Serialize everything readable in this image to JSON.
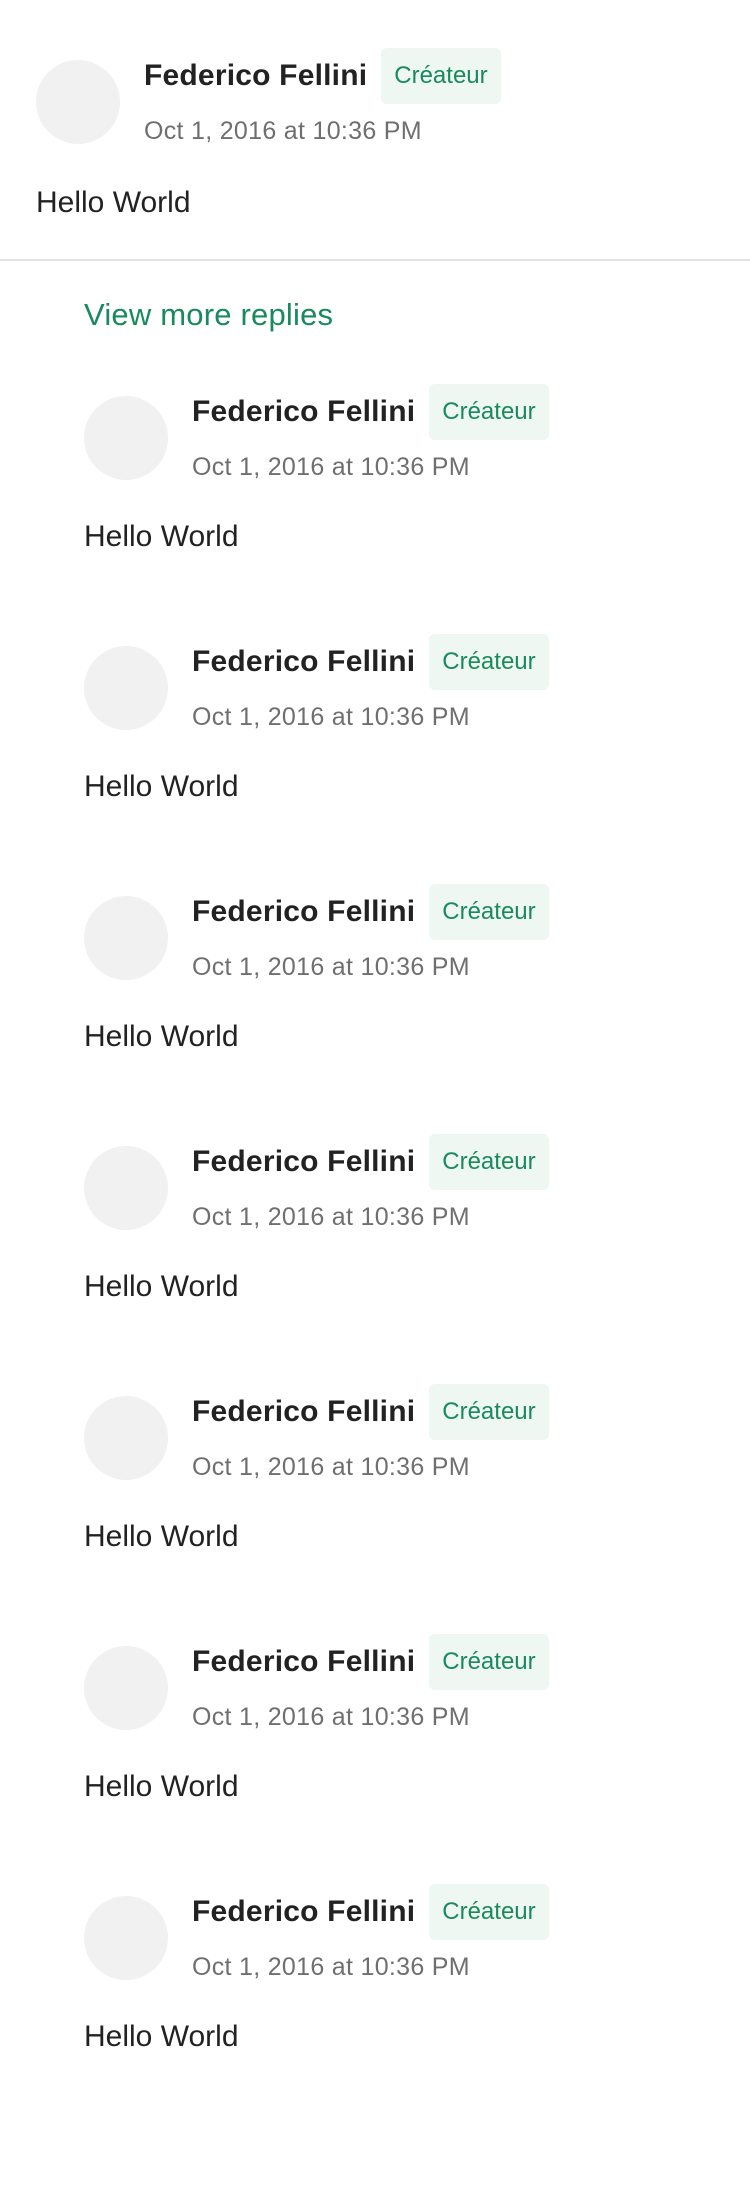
{
  "root_comment": {
    "author": "Federico Fellini",
    "badge": "Créateur",
    "timestamp": "Oct 1, 2016 at 10:36 PM",
    "text": "Hello World"
  },
  "view_more_label": "View more replies",
  "replies": [
    {
      "author": "Federico Fellini",
      "badge": "Créateur",
      "timestamp": "Oct 1, 2016 at 10:36 PM",
      "text": "Hello World"
    },
    {
      "author": "Federico Fellini",
      "badge": "Créateur",
      "timestamp": "Oct 1, 2016 at 10:36 PM",
      "text": "Hello World"
    },
    {
      "author": "Federico Fellini",
      "badge": "Créateur",
      "timestamp": "Oct 1, 2016 at 10:36 PM",
      "text": "Hello World"
    },
    {
      "author": "Federico Fellini",
      "badge": "Créateur",
      "timestamp": "Oct 1, 2016 at 10:36 PM",
      "text": "Hello World"
    },
    {
      "author": "Federico Fellini",
      "badge": "Créateur",
      "timestamp": "Oct 1, 2016 at 10:36 PM",
      "text": "Hello World"
    },
    {
      "author": "Federico Fellini",
      "badge": "Créateur",
      "timestamp": "Oct 1, 2016 at 10:36 PM",
      "text": "Hello World"
    },
    {
      "author": "Federico Fellini",
      "badge": "Créateur",
      "timestamp": "Oct 1, 2016 at 10:36 PM",
      "text": "Hello World"
    }
  ],
  "colors": {
    "accent": "#1a8a5e",
    "badge_background": "#eef7f2",
    "avatar_placeholder": "#f1f1f1",
    "divider": "#e4e4e4"
  }
}
